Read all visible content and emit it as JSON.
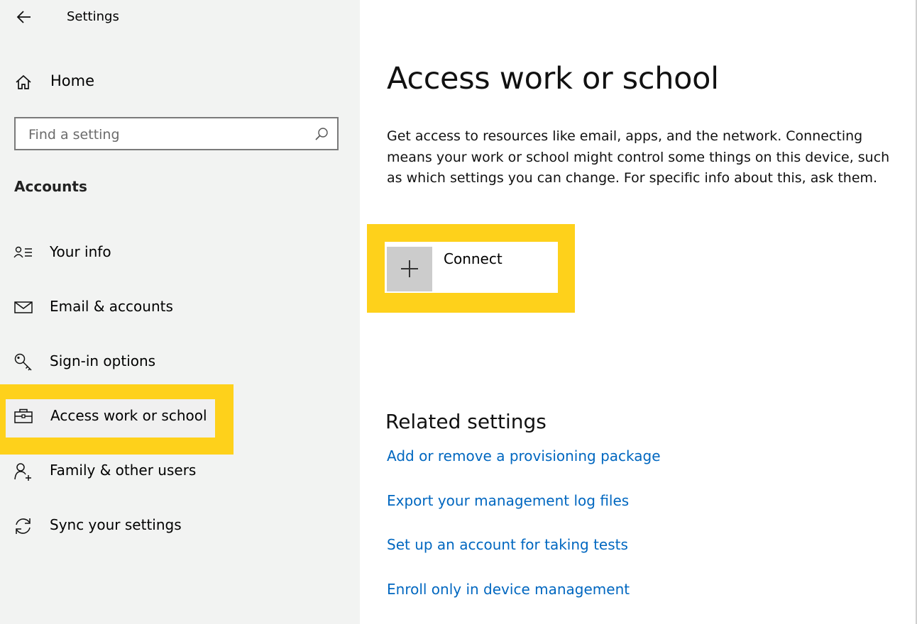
{
  "header": {
    "title": "Settings",
    "back_icon": "back-arrow-icon"
  },
  "sidebar": {
    "home_label": "Home",
    "search_placeholder": "Find a setting",
    "section_title": "Accounts",
    "items": [
      {
        "label": "Your info",
        "icon": "person-list-icon"
      },
      {
        "label": "Email & accounts",
        "icon": "mail-icon"
      },
      {
        "label": "Sign-in options",
        "icon": "key-icon"
      },
      {
        "label": "Access work or school",
        "icon": "briefcase-icon",
        "selected": true
      },
      {
        "label": "Family & other users",
        "icon": "person-add-icon"
      },
      {
        "label": "Sync your settings",
        "icon": "sync-icon"
      }
    ]
  },
  "main": {
    "title": "Access work or school",
    "description": "Get access to resources like email, apps, and the network. Connecting means your work or school might control some things on this device, such as which settings you can change. For specific info about this, ask them.",
    "connect_label": "Connect",
    "related_title": "Related settings",
    "links": [
      "Add or remove a provisioning package",
      "Export your management log files",
      "Set up an account for taking tests",
      "Enroll only in device management"
    ]
  },
  "colors": {
    "highlight": "#fed11b",
    "link": "#0067c0",
    "sidebar_bg": "#f2f3f2"
  }
}
